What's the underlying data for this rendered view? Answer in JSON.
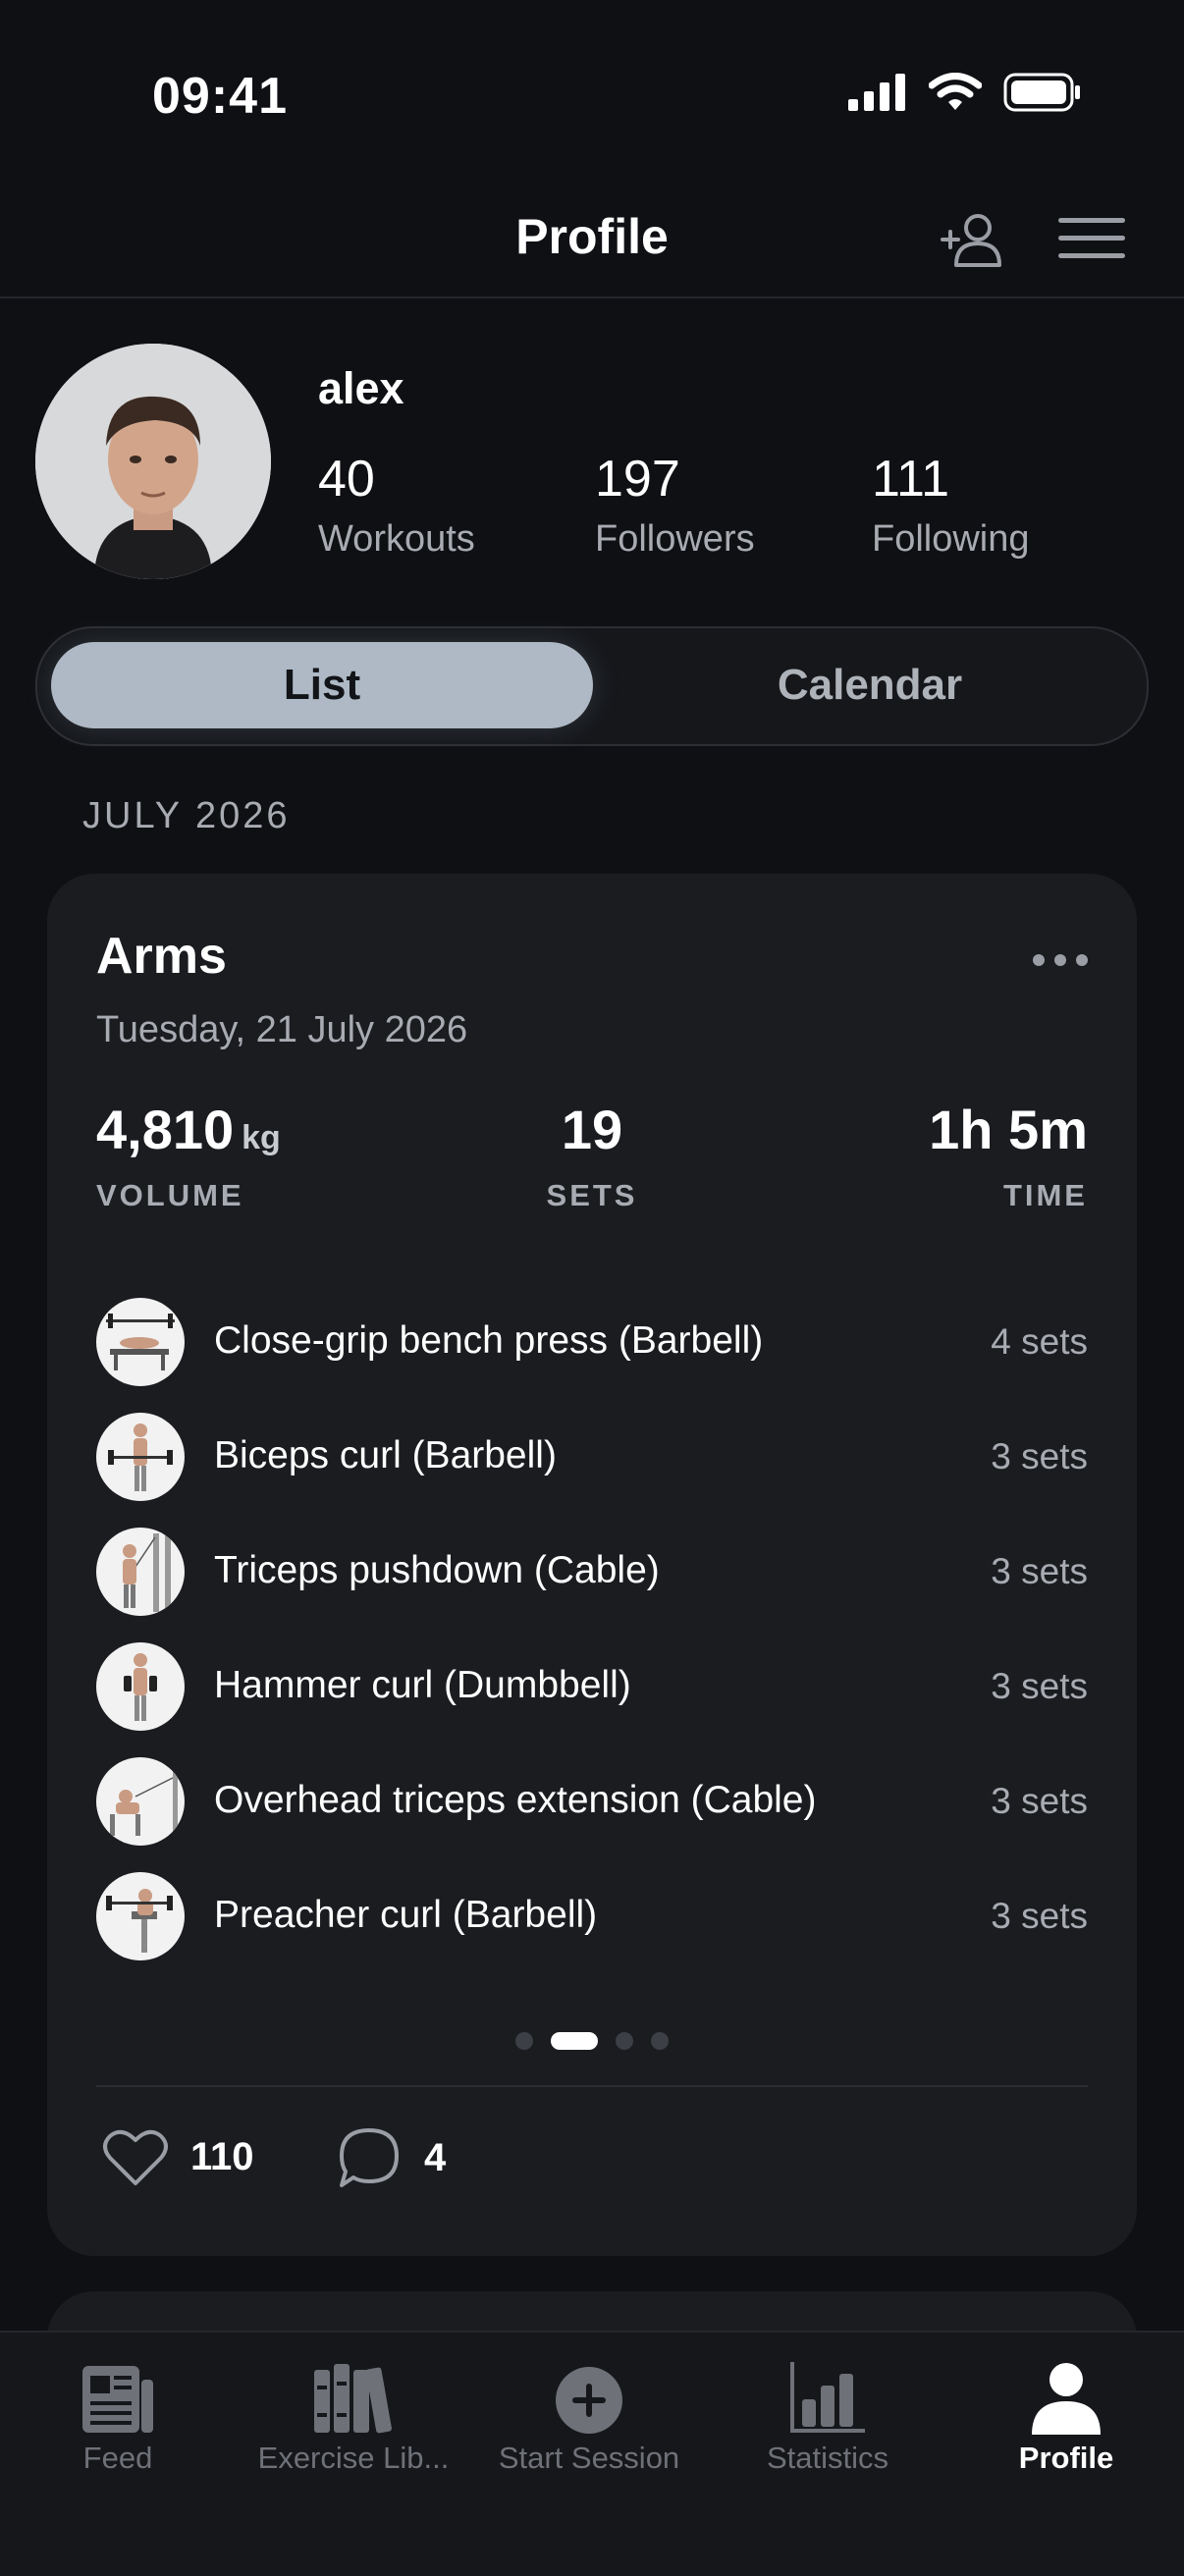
{
  "status_bar": {
    "time": "09:41"
  },
  "nav": {
    "title": "Profile"
  },
  "profile": {
    "username": "alex",
    "stats": [
      {
        "value": "40",
        "label": "Workouts"
      },
      {
        "value": "197",
        "label": "Followers"
      },
      {
        "value": "111",
        "label": "Following"
      }
    ]
  },
  "view_toggle": {
    "list": "List",
    "calendar": "Calendar",
    "selected": "List"
  },
  "section": {
    "month": "JULY 2026"
  },
  "workout": {
    "title": "Arms",
    "date": "Tuesday, 21 July 2026",
    "volume": {
      "value": "4,810",
      "unit": "kg",
      "label": "VOLUME"
    },
    "sets": {
      "value": "19",
      "label": "SETS"
    },
    "time": {
      "value": "1h 5m",
      "label": "TIME"
    },
    "exercises": [
      {
        "name": "Close-grip bench press (Barbell)",
        "sets": "4 sets"
      },
      {
        "name": "Biceps curl (Barbell)",
        "sets": "3 sets"
      },
      {
        "name": "Triceps pushdown (Cable)",
        "sets": "3 sets"
      },
      {
        "name": "Hammer curl (Dumbbell)",
        "sets": "3 sets"
      },
      {
        "name": "Overhead triceps extension (Cable)",
        "sets": "3 sets"
      },
      {
        "name": "Preacher curl (Barbell)",
        "sets": "3 sets"
      }
    ],
    "pager": {
      "pages": 4,
      "active_index": 1
    },
    "likes": "110",
    "comments": "4"
  },
  "tab_bar": {
    "tabs": [
      {
        "label": "Feed",
        "icon": "feed-icon"
      },
      {
        "label": "Exercise Lib...",
        "icon": "library-icon"
      },
      {
        "label": "Start Session",
        "icon": "plus-circle-icon"
      },
      {
        "label": "Statistics",
        "icon": "bar-chart-icon"
      },
      {
        "label": "Profile",
        "icon": "person-icon"
      }
    ],
    "active": "Profile"
  },
  "colors": {
    "background": "#0f1014",
    "card": "#1a1c20",
    "toggle_selected": "#aeb9c5",
    "secondary_text": "#a8abb2",
    "tab_inactive": "#6e7178"
  }
}
